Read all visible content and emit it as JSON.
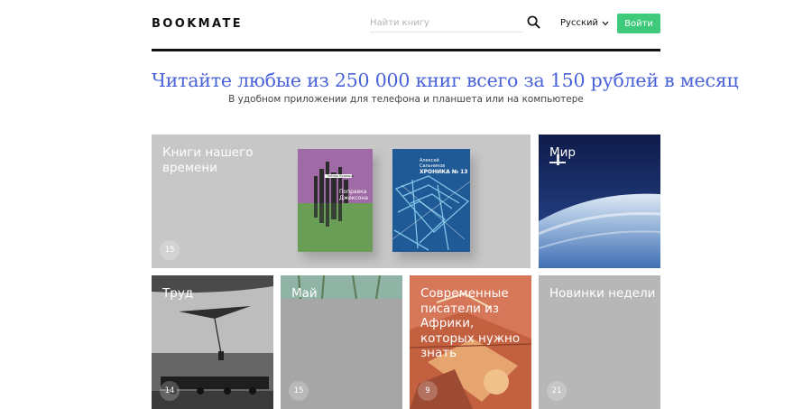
{
  "header": {
    "logo": "BOOKMATE",
    "search_placeholder": "Найти книгу",
    "search_icon": "search-icon",
    "language": "Русский",
    "login": "Войти",
    "accent_color": "#3fc97a"
  },
  "hero": {
    "headline": "Читайте любые из 250 000 книг всего за 150 рублей в месяц",
    "subline": "В удобном приложении для телефона и планшета или на компьютере",
    "headline_color": "#4a62d8"
  },
  "collections": [
    {
      "title": "Книги нашего времени",
      "count": "15",
      "books": [
        {
          "author": "Тейлор Вудвард",
          "title": "Поправка Джексона"
        },
        {
          "author": "Алексей Сальников",
          "title": "ХРОНИКА № 13"
        }
      ]
    },
    {
      "title": "Мир",
      "count": ""
    },
    {
      "title": "Труд",
      "count": "14"
    },
    {
      "title": "Май",
      "count": "15"
    },
    {
      "title": "Современные писатели из Африки, которых нужно знать",
      "count": "9"
    },
    {
      "title": "Новинки недели",
      "count": "21"
    }
  ]
}
